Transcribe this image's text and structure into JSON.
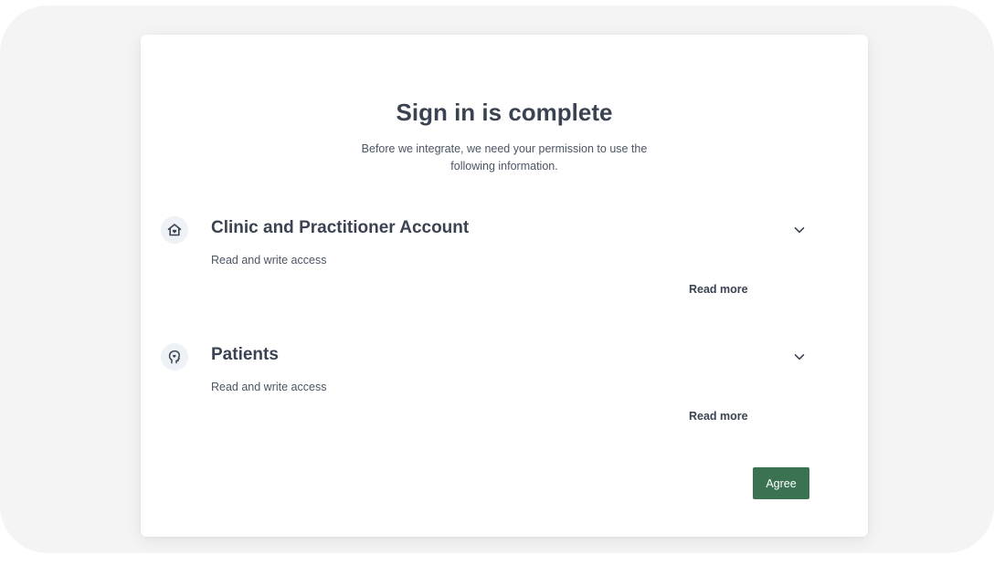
{
  "dialog": {
    "title": "Sign in is complete",
    "subtitle": "Before we integrate, we need your permission to use the following information."
  },
  "permissions": [
    {
      "title": "Clinic and Practitioner Account",
      "access": "Read and write access",
      "read_more": "Read more",
      "icon": "house-heart-icon"
    },
    {
      "title": "Patients",
      "access": "Read and write access",
      "read_more": "Read more",
      "icon": "head-heart-icon"
    }
  ],
  "actions": {
    "agree_label": "Agree"
  },
  "colors": {
    "primary_button": "#3b7352",
    "heading_text": "#3b4352",
    "body_text": "#4b5563",
    "background_frame": "#f4f4f5",
    "icon_bg": "#eef1f5"
  }
}
